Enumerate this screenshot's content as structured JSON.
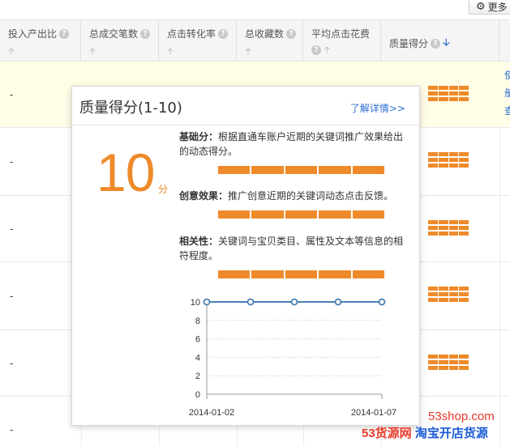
{
  "toolbar": {
    "more_label": "更多"
  },
  "columns": [
    {
      "label": "投入产出比"
    },
    {
      "label": "总成交笔数"
    },
    {
      "label": "点击转化率"
    },
    {
      "label": "总收藏数"
    },
    {
      "label": "平均点击花费"
    },
    {
      "label": "质量得分"
    }
  ],
  "rows": [
    "-",
    "-",
    "-",
    "-",
    "-",
    "-"
  ],
  "edge_text": [
    "使",
    "册",
    "查"
  ],
  "popup": {
    "title": "质量得分(1-10)",
    "link": "了解详情>>",
    "score": "10",
    "score_unit": "分",
    "sections": [
      {
        "label": "基础分：",
        "text": "根据直通车账户近期的关键词推广效果给出的动态得分。"
      },
      {
        "label": "创意效果：",
        "text": "推广创意近期的关键词动态点击反馈。"
      },
      {
        "label": "相关性：",
        "text": "关键词与宝贝类目、属性及文本等信息的相符程度。"
      }
    ]
  },
  "chart_data": {
    "type": "line",
    "x": [
      "2014-01-02",
      "2014-01-03",
      "2014-01-04",
      "2014-01-05",
      "2014-01-07"
    ],
    "x_tick_labels": [
      "2014-01-02",
      "2014-01-07"
    ],
    "series": [
      {
        "values": [
          10,
          10,
          10,
          10,
          10
        ]
      }
    ],
    "ylim": [
      0,
      10
    ],
    "yticks": [
      0,
      2,
      4,
      6,
      8,
      10
    ],
    "grid": true,
    "color": "#4a7fb5"
  },
  "watermark": {
    "site": "53shop.com",
    "brand_a": "53货源网",
    "brand_b": "淘宝开店货源"
  }
}
